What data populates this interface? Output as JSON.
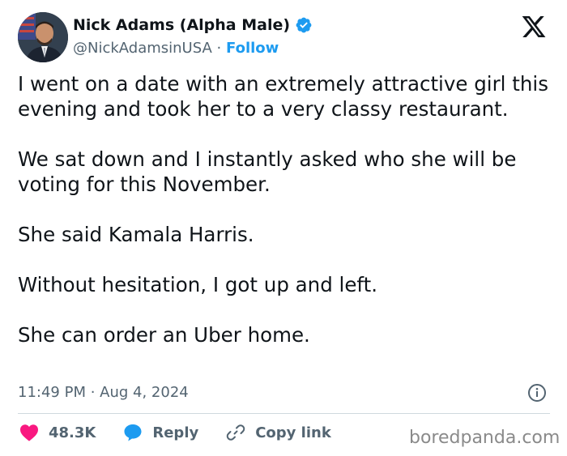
{
  "author": {
    "display_name": "Nick Adams (Alpha Male)",
    "handle": "@NickAdamsinUSA",
    "separator": "·",
    "follow_label": "Follow",
    "verified": true
  },
  "tweet": {
    "paragraphs": [
      "I went on a date with an extremely attractive girl this evening and took her to a very classy restaurant.",
      "We sat down and I instantly asked who she will be voting for this November.",
      "She said Kamala Harris.",
      "Without hesitation, I got up and left.",
      "She can order an Uber home."
    ],
    "timestamp": "11:49 PM · Aug 4, 2024"
  },
  "actions": {
    "likes": "48.3K",
    "reply_label": "Reply",
    "copy_link_label": "Copy link"
  },
  "watermark": "boredpanda.com",
  "icons": {
    "logo": "x-logo-icon",
    "verified": "verified-badge-icon",
    "info": "info-icon",
    "like": "heart-icon",
    "reply": "speech-bubble-icon",
    "copy": "link-icon"
  },
  "colors": {
    "text": "#0f1419",
    "secondary": "#536471",
    "accent": "#1d9bf0",
    "like": "#f91880",
    "divider": "#cfd9de",
    "watermark": "#8a8a8a"
  }
}
